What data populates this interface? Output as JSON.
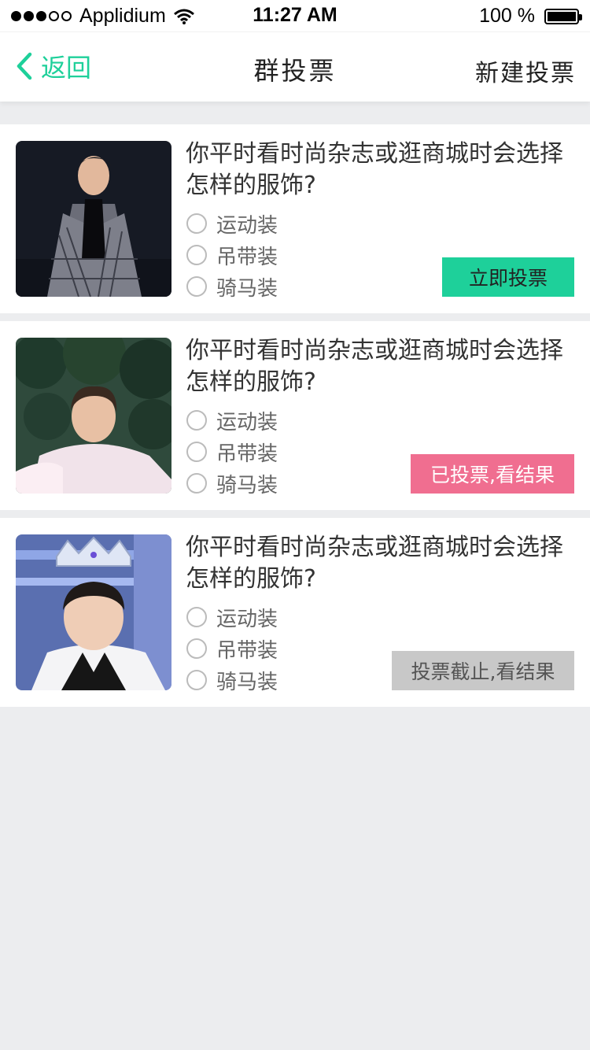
{
  "status_bar": {
    "carrier": "Applidium",
    "time": "11:27 AM",
    "battery": "100 %",
    "battery_level": 1.0,
    "signal_bars_filled": 3,
    "signal_bars_total": 5
  },
  "nav": {
    "back_label": "返回",
    "title": "群投票",
    "action_label": "新建投票"
  },
  "colors": {
    "accent": "#1ed09a",
    "voted": "#f06e90",
    "ended": "#c8c8c8",
    "background": "#ecedef"
  },
  "polls": [
    {
      "question": "你平时看时尚杂志或逛商城时会选择怎样的服饰?",
      "options": [
        "运动装",
        "吊带装",
        "骑马装"
      ],
      "button_label": "立即投票",
      "status": "open"
    },
    {
      "question": "你平时看时尚杂志或逛商城时会选择怎样的服饰?",
      "options": [
        "运动装",
        "吊带装",
        "骑马装"
      ],
      "button_label": "已投票,看结果",
      "status": "voted"
    },
    {
      "question": "你平时看时尚杂志或逛商城时会选择怎样的服饰?",
      "options": [
        "运动装",
        "吊带装",
        "骑马装"
      ],
      "button_label": "投票截止,看结果",
      "status": "ended"
    }
  ]
}
